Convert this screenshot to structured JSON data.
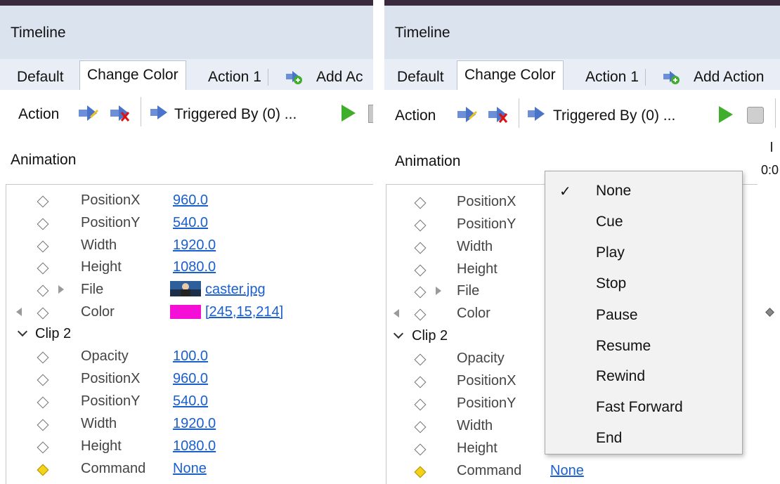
{
  "left_panel": {
    "title": "Timeline",
    "tabs": [
      "Default",
      "Change Color",
      "Action 1",
      "Add Ac"
    ],
    "toolbar": {
      "action_label": "Action",
      "triggered_label": "Triggered By (0) ..."
    },
    "animation_label": "Animation",
    "clip1_rows": [
      {
        "key": "PositionX",
        "value": "960.0"
      },
      {
        "key": "PositionY",
        "value": "540.0"
      },
      {
        "key": "Width",
        "value": "1920.0"
      },
      {
        "key": "Height",
        "value": "1080.0"
      },
      {
        "key": "File",
        "value": "caster.jpg"
      },
      {
        "key": "Color",
        "value": "[245,15,214]"
      }
    ],
    "clip2_label": "Clip 2",
    "clip2_rows": [
      {
        "key": "Opacity",
        "value": "100.0"
      },
      {
        "key": "PositionX",
        "value": "960.0"
      },
      {
        "key": "PositionY",
        "value": "540.0"
      },
      {
        "key": "Width",
        "value": "1920.0"
      },
      {
        "key": "Height",
        "value": "1080.0"
      },
      {
        "key": "Command",
        "value": "None"
      }
    ]
  },
  "right_panel": {
    "title": "Timeline",
    "tabs": [
      "Default",
      "Change Color",
      "Action 1",
      "Add Action"
    ],
    "toolbar": {
      "action_label": "Action",
      "triggered_label": "Triggered By (0) ..."
    },
    "animation_label": "Animation",
    "ruler_label": "0:0",
    "clip1_keys": [
      "PositionX",
      "PositionY",
      "Width",
      "Height",
      "File",
      "Color"
    ],
    "clip2_label": "Clip 2",
    "clip2_keys": [
      "Opacity",
      "PositionX",
      "PositionY",
      "Width",
      "Height",
      "Command"
    ],
    "command_value": "None"
  },
  "dropdown_menu": {
    "items": [
      "None",
      "Cue",
      "Play",
      "Stop",
      "Pause",
      "Resume",
      "Rewind",
      "Fast Forward",
      "End"
    ],
    "checked": "None",
    "check_glyph": "✓"
  },
  "colors": {
    "swatch": "#f50fd6",
    "link": "#1a5fd0",
    "title_bar": "#dbe3ef",
    "play_green": "#3fae2a",
    "keyframe_gold": "#f3d21a"
  },
  "icons": [
    "arrow-right-icon",
    "delete-arrow-icon",
    "trigger-icon",
    "add-action-icon",
    "play-icon",
    "stop-icon",
    "thumbnail-icon"
  ]
}
